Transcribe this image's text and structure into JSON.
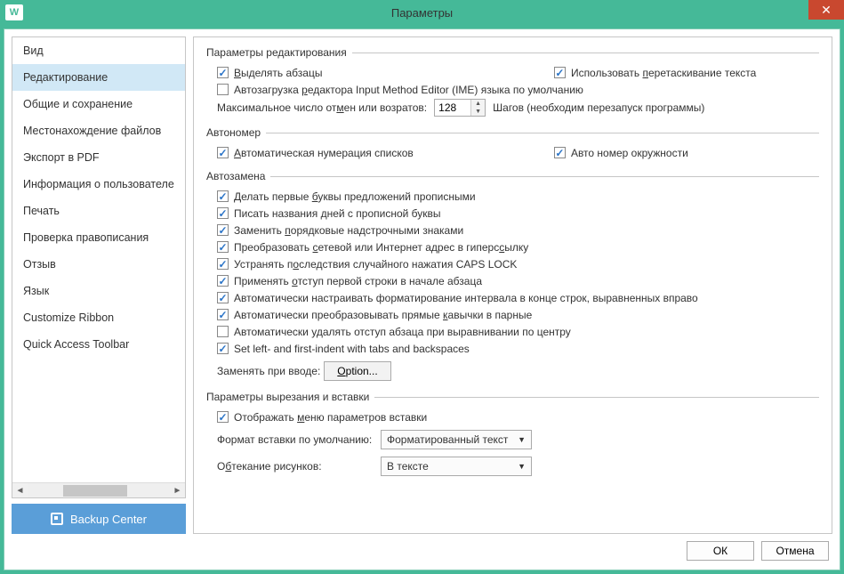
{
  "window": {
    "title": "Параметры",
    "app_icon_letter": "W"
  },
  "sidebar": {
    "items": [
      "Вид",
      "Редактирование",
      "Общие и сохранение",
      "Местонахождение файлов",
      "Экспорт в PDF",
      "Информация о пользователе",
      "Печать",
      "Проверка правописания",
      "Отзыв",
      "Язык",
      "Customize Ribbon",
      "Quick Access Toolbar"
    ],
    "selected_index": 1,
    "backup_label": "Backup Center"
  },
  "groups": {
    "edit": {
      "title": "Параметры редактирования",
      "highlight_paragraphs": {
        "label_pre": "",
        "label_u": "В",
        "label_post": "ыделять абзацы",
        "checked": true
      },
      "drag_text": {
        "label_pre": "Использовать ",
        "label_u": "п",
        "label_post": "еретаскивание текста",
        "checked": true
      },
      "ime_autoload": {
        "label_pre": "Автозагрузка ",
        "label_u": "р",
        "label_post": "едактора Input Method Editor (IME) языка по умолчанию",
        "checked": false
      },
      "undo_label_pre": "Максимальное число от",
      "undo_label_u": "м",
      "undo_label_post": "ен или возратов:",
      "undo_value": "128",
      "undo_suffix": "Шагов (необходим перезапуск программы)"
    },
    "autonum": {
      "title": "Автономер",
      "auto_list": {
        "label_u": "А",
        "label_post": "втоматическая нумерация списков",
        "checked": true
      },
      "auto_circle": {
        "label": "Авто номер окружности",
        "checked": true
      }
    },
    "autocorrect": {
      "title": "Автозамена",
      "items": [
        {
          "checked": true,
          "pre": "Делать первые ",
          "u": "б",
          "post": "уквы предложений прописными"
        },
        {
          "checked": true,
          "pre": "Писать названия ",
          "u": "д",
          "post": "ней с прописной буквы"
        },
        {
          "checked": true,
          "pre": "Заменить ",
          "u": "п",
          "post": "орядковые надстрочными знаками"
        },
        {
          "checked": true,
          "pre": "Преобразовать ",
          "u": "с",
          "post": "етевой или Интернет адрес в гиперс",
          "u2": "с",
          "post2": "ылку"
        },
        {
          "checked": true,
          "pre": "Устранять п",
          "u": "о",
          "post": "следствия случайного нажатия CAPS LOCK"
        },
        {
          "checked": true,
          "pre": "Применять ",
          "u": "о",
          "post": "тступ первой строки в начале абзаца"
        },
        {
          "checked": true,
          "pre": "Автоматически настраивать форматирование интервала в конце строк, выравненных вправо",
          "u": "",
          "post": ""
        },
        {
          "checked": true,
          "pre": "Автоматически преобразовывать прямые ",
          "u": "к",
          "post": "авычки в парные"
        },
        {
          "checked": false,
          "pre": "Автоматически удалять отступ абзаца при выравнивании по центру",
          "u": "",
          "post": ""
        },
        {
          "checked": true,
          "pre": "Set left- and first-indent with tabs and backspaces",
          "u": "",
          "post": ""
        }
      ],
      "replace_label": "Заменять при вводе:",
      "option_btn_u": "O",
      "option_btn_post": "ption..."
    },
    "cutpaste": {
      "title": "Параметры вырезания и вставки",
      "show_paste_opts": {
        "pre": "Отображать ",
        "u": "м",
        "post": "еню параметров вставки",
        "checked": true
      },
      "paste_format_label": "Формат вставки по умолчанию:",
      "paste_format_value": "Форматированный текст",
      "wrap_label_pre": "О",
      "wrap_label_u": "б",
      "wrap_label_post": "текание рисунков:",
      "wrap_value": "В тексте"
    }
  },
  "footer": {
    "ok": "ОК",
    "cancel": "Отмена"
  }
}
